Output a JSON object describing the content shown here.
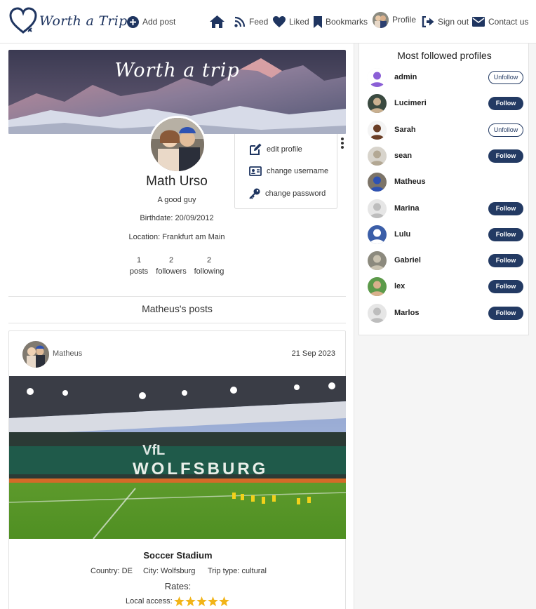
{
  "nav": {
    "logo_text": "Worth a Trip",
    "add_post": "Add post",
    "feed": "Feed",
    "liked": "Liked",
    "bookmarks": "Bookmarks",
    "profile": "Profile",
    "sign_out": "Sign out",
    "contact_us": "Contact us"
  },
  "profile": {
    "banner_title": "Worth a trip",
    "name": "Math Urso",
    "bio": "A good guy",
    "birthdate": "Birthdate: 20/09/2012",
    "location": "Location: Frankfurt am Main",
    "stats": [
      {
        "value": "1",
        "label": "posts"
      },
      {
        "value": "2",
        "label": "followers"
      },
      {
        "value": "2",
        "label": "following"
      }
    ],
    "menu": {
      "edit_profile": "edit profile",
      "change_username": "change username",
      "change_password": "change password"
    }
  },
  "posts_section": {
    "title": "Matheus's posts"
  },
  "post": {
    "user": "Matheus",
    "date": "21 Sep 2023",
    "photo_text": "WOLFSBURG",
    "photo_sign": "VfL",
    "title": "Soccer Stadium",
    "country": "Country: DE",
    "city": "City: Wolfsburg",
    "trip_type": "Trip type: cultural",
    "rates_label": "Rates:",
    "local_access_label": "Local access:",
    "local_access_rating": 5
  },
  "most_followed": {
    "title": "Most followed profiles",
    "profiles": [
      {
        "name": "admin",
        "button": "Unfollow"
      },
      {
        "name": "Lucimeri",
        "button": "Follow"
      },
      {
        "name": "Sarah",
        "button": "Unfollow"
      },
      {
        "name": "sean",
        "button": "Follow"
      },
      {
        "name": "Matheus",
        "button": ""
      },
      {
        "name": "Marina",
        "button": "Follow"
      },
      {
        "name": "Lulu",
        "button": "Follow"
      },
      {
        "name": "Gabriel",
        "button": "Follow"
      },
      {
        "name": "lex",
        "button": "Follow"
      },
      {
        "name": "Marlos",
        "button": "Follow"
      }
    ]
  },
  "colors": {
    "brand": "#1f3560",
    "button": "#233a63",
    "star": "#f2b418"
  }
}
